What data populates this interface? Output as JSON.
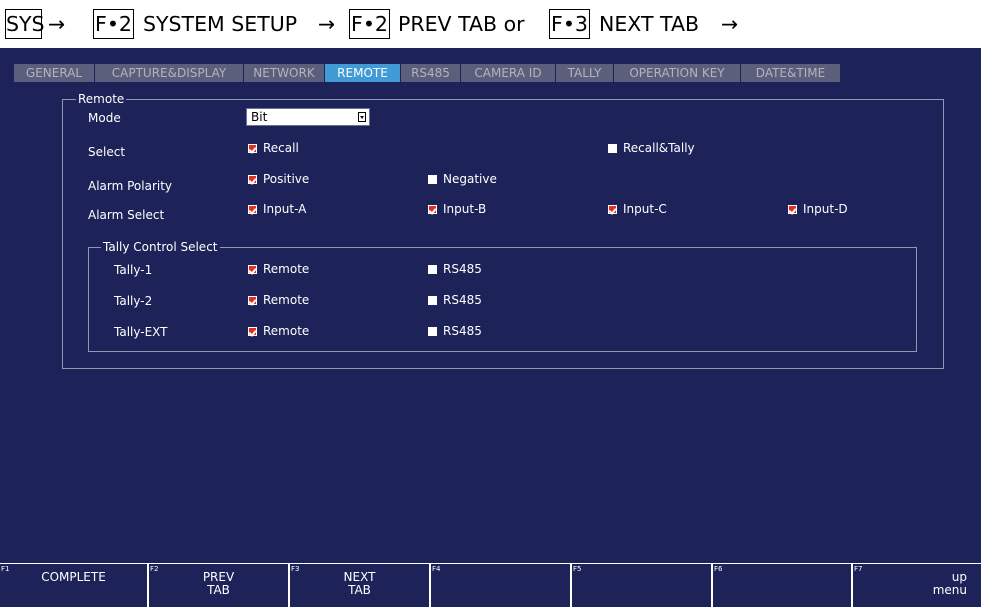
{
  "breadcrumb": {
    "sys": "SYS",
    "arrow": "→",
    "key1": "F•2",
    "text1": "SYSTEM SETUP",
    "key2": "F•2",
    "text2": "PREV TAB or",
    "key3": "F•3",
    "text3": "NEXT TAB"
  },
  "tabs": [
    "GENERAL",
    "CAPTURE&DISPLAY",
    "NETWORK",
    "REMOTE",
    "RS485",
    "CAMERA ID",
    "TALLY",
    "OPERATION KEY",
    "DATE&TIME"
  ],
  "active_tab": "REMOTE",
  "remote": {
    "group_title": "Remote",
    "mode_label": "Mode",
    "mode_value": "Bit",
    "select_label": "Select",
    "select_options": [
      {
        "label": "Recall",
        "checked": true
      },
      {
        "label": "Recall&Tally",
        "checked": false
      }
    ],
    "alarm_polarity_label": "Alarm Polarity",
    "alarm_polarity_options": [
      {
        "label": "Positive",
        "checked": true
      },
      {
        "label": "Negative",
        "checked": false
      }
    ],
    "alarm_select_label": "Alarm Select",
    "alarm_select_options": [
      {
        "label": "Input-A",
        "checked": true
      },
      {
        "label": "Input-B",
        "checked": true
      },
      {
        "label": "Input-C",
        "checked": true
      },
      {
        "label": "Input-D",
        "checked": true
      }
    ]
  },
  "tally_control": {
    "group_title": "Tally Control Select",
    "rows": [
      {
        "label": "Tally-1",
        "options": [
          {
            "label": "Remote",
            "checked": true
          },
          {
            "label": "RS485",
            "checked": false
          }
        ]
      },
      {
        "label": "Tally-2",
        "options": [
          {
            "label": "Remote",
            "checked": true
          },
          {
            "label": "RS485",
            "checked": false
          }
        ]
      },
      {
        "label": "Tally-EXT",
        "options": [
          {
            "label": "Remote",
            "checked": true
          },
          {
            "label": "RS485",
            "checked": false
          }
        ]
      }
    ]
  },
  "function_keys": [
    {
      "num": "F1",
      "label": "COMPLETE"
    },
    {
      "num": "F2",
      "label": "PREV\nTAB"
    },
    {
      "num": "F3",
      "label": "NEXT\nTAB"
    },
    {
      "num": "F4",
      "label": ""
    },
    {
      "num": "F5",
      "label": ""
    },
    {
      "num": "F6",
      "label": ""
    },
    {
      "num": "F7",
      "label": "up\nmenu"
    }
  ],
  "colors": {
    "screen_bg": "#1d2358",
    "tab_bg": "#5c5f7b",
    "tab_active_bg": "#3f9ad6",
    "check_on": "#e03020"
  }
}
